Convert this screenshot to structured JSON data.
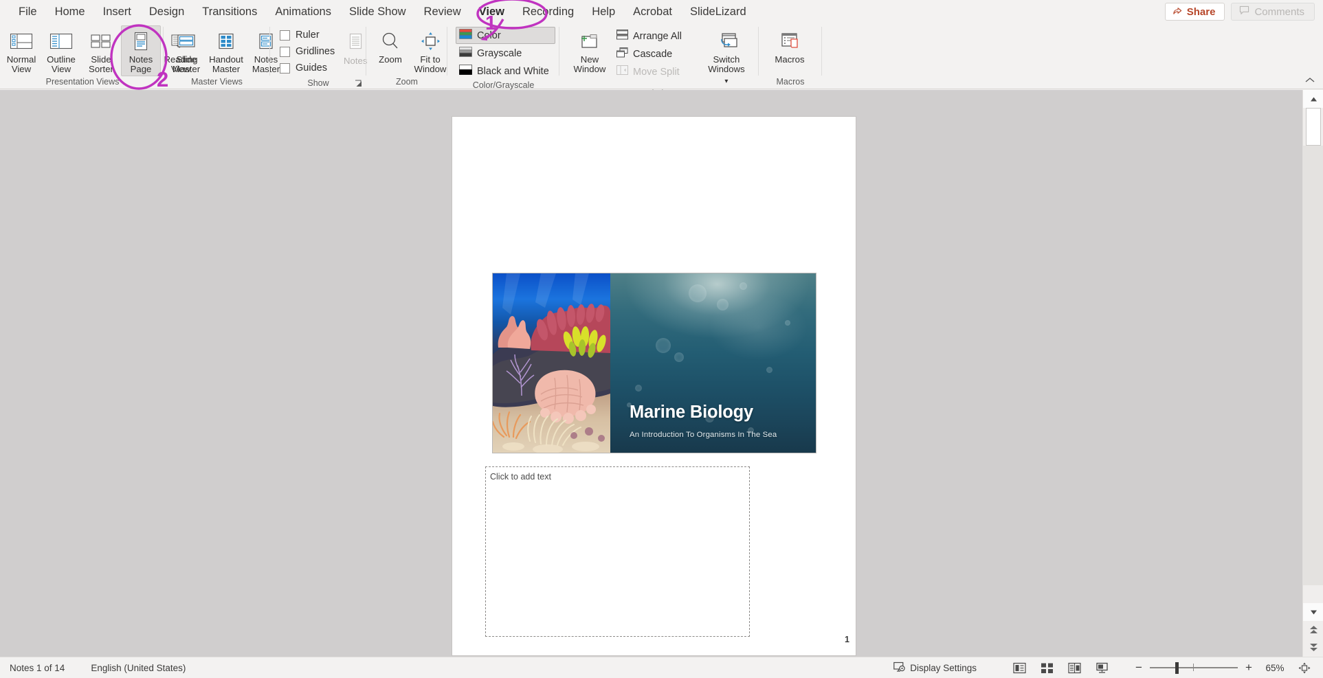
{
  "app": {
    "name": "Microsoft PowerPoint",
    "accent_color": "#b7472a",
    "annotation_color": "#c033c0",
    "ribbon_bg": "#f3f2f1",
    "canvas_bg": "#d0cece"
  },
  "menubar": {
    "tabs": [
      {
        "label": "File",
        "active": false
      },
      {
        "label": "Home",
        "active": false
      },
      {
        "label": "Insert",
        "active": false
      },
      {
        "label": "Design",
        "active": false
      },
      {
        "label": "Transitions",
        "active": false
      },
      {
        "label": "Animations",
        "active": false
      },
      {
        "label": "Slide Show",
        "active": false
      },
      {
        "label": "Review",
        "active": false
      },
      {
        "label": "View",
        "active": true
      },
      {
        "label": "Recording",
        "active": false
      },
      {
        "label": "Help",
        "active": false
      },
      {
        "label": "Acrobat",
        "active": false
      },
      {
        "label": "SlideLizard",
        "active": false
      }
    ],
    "share_label": "Share",
    "share_icon": "share-icon",
    "comments_label": "Comments",
    "comments_icon": "comment-bubble-icon",
    "comments_disabled": true
  },
  "ribbon": {
    "collapse_icon": "chevron-up-icon",
    "groups": [
      {
        "name": "Presentation Views",
        "label": "Presentation Views",
        "buttons": [
          {
            "label": "Normal",
            "label_line1": "Normal",
            "label_line2": "View",
            "icon": "normal-view-icon",
            "selected": false,
            "disabled": false
          },
          {
            "label": "Outline View",
            "label_line1": "Outline",
            "label_line2": "View",
            "icon": "outline-view-icon",
            "selected": false,
            "disabled": false
          },
          {
            "label": "Slide Sorter",
            "label_line1": "Slide",
            "label_line2": "Sorter",
            "icon": "slide-sorter-icon",
            "selected": false,
            "disabled": false
          },
          {
            "label": "Notes Page",
            "label_line1": "Notes",
            "label_line2": "Page",
            "icon": "notes-page-icon",
            "selected": true,
            "disabled": false
          },
          {
            "label": "Reading View",
            "label_line1": "Reading",
            "label_line2": "View",
            "icon": "reading-view-icon",
            "selected": false,
            "disabled": false
          }
        ]
      },
      {
        "name": "Master Views",
        "label": "Master Views",
        "buttons": [
          {
            "label": "Slide Master",
            "label_line1": "Slide",
            "label_line2": "Master",
            "icon": "slide-master-icon",
            "selected": false,
            "disabled": false
          },
          {
            "label": "Handout Master",
            "label_line1": "Handout",
            "label_line2": "Master",
            "icon": "handout-master-icon",
            "selected": false,
            "disabled": false
          },
          {
            "label": "Notes Master",
            "label_line1": "Notes",
            "label_line2": "Master",
            "icon": "notes-master-icon",
            "selected": false,
            "disabled": false
          }
        ]
      },
      {
        "name": "Show",
        "label": "Show",
        "has_dialog_launcher": true,
        "checkboxes": [
          {
            "label": "Ruler",
            "checked": false
          },
          {
            "label": "Gridlines",
            "checked": false
          },
          {
            "label": "Guides",
            "checked": false
          }
        ],
        "buttons": [
          {
            "label": "Notes",
            "label_line1": "Notes",
            "label_line2": "",
            "icon": "notes-icon",
            "selected": false,
            "disabled": true
          }
        ]
      },
      {
        "name": "Zoom",
        "label": "Zoom",
        "buttons": [
          {
            "label": "Zoom",
            "label_line1": "Zoom",
            "label_line2": "",
            "icon": "magnifier-icon",
            "selected": false,
            "disabled": false
          },
          {
            "label": "Fit to Window",
            "label_line1": "Fit to",
            "label_line2": "Window",
            "icon": "fit-to-window-icon",
            "selected": false,
            "disabled": false
          }
        ]
      },
      {
        "name": "Color/Grayscale",
        "label": "Color/Grayscale",
        "rows": [
          {
            "label": "Color",
            "icon": "color-swatch-icon",
            "selected": true,
            "disabled": false
          },
          {
            "label": "Grayscale",
            "icon": "grayscale-swatch-icon",
            "selected": false,
            "disabled": false
          },
          {
            "label": "Black and White",
            "icon": "black-white-swatch-icon",
            "selected": false,
            "disabled": false
          }
        ]
      },
      {
        "name": "Window",
        "label": "Window",
        "buttons": [
          {
            "label": "New Window",
            "label_line1": "New",
            "label_line2": "Window",
            "icon": "new-window-icon",
            "selected": false,
            "disabled": false
          },
          {
            "label": "Switch Windows",
            "label_line1": "Switch",
            "label_line2": "Windows",
            "icon": "switch-windows-icon",
            "selected": false,
            "disabled": false,
            "has_chevron": true
          }
        ],
        "rows": [
          {
            "label": "Arrange All",
            "icon": "arrange-all-icon",
            "selected": false,
            "disabled": false
          },
          {
            "label": "Cascade",
            "icon": "cascade-icon",
            "selected": false,
            "disabled": false
          },
          {
            "label": "Move Split",
            "icon": "move-split-icon",
            "selected": false,
            "disabled": true
          }
        ]
      },
      {
        "name": "Macros",
        "label": "Macros",
        "buttons": [
          {
            "label": "Macros",
            "label_line1": "Macros",
            "label_line2": "",
            "icon": "macros-icon",
            "selected": false,
            "disabled": false
          }
        ]
      }
    ]
  },
  "document": {
    "slide": {
      "title": "Marine Biology",
      "subtitle": "An Introduction To Organisms In The Sea",
      "left_image_alt": "coral-reef-photo"
    },
    "notes_placeholder": "Click to add text",
    "page_number": "1"
  },
  "scrollbar": {
    "up_icon": "scroll-up-icon",
    "down_icon": "scroll-down-icon",
    "prev_page_icon": "previous-page-icon",
    "next_page_icon": "next-page-icon"
  },
  "statusbar": {
    "slide_counter": "Notes 1 of 14",
    "language": "English (United States)",
    "display_settings_label": "Display Settings",
    "display_settings_icon": "display-settings-icon",
    "view_buttons": [
      {
        "name": "normal-view",
        "icon": "normal-view-small-icon"
      },
      {
        "name": "slide-sorter-view",
        "icon": "slide-sorter-small-icon"
      },
      {
        "name": "reading-view",
        "icon": "reading-view-small-icon"
      },
      {
        "name": "slide-show-view",
        "icon": "slide-show-small-icon"
      }
    ],
    "zoom_out_label": "−",
    "zoom_in_label": "+",
    "zoom_level": "65%",
    "fit_slide_icon": "fit-slide-to-window-icon"
  },
  "annotations": [
    {
      "id": "1",
      "label": "1",
      "target": "View tab",
      "shape": "ellipse"
    },
    {
      "id": "2",
      "label": "2",
      "target": "Notes Page button",
      "shape": "ellipse"
    }
  ]
}
